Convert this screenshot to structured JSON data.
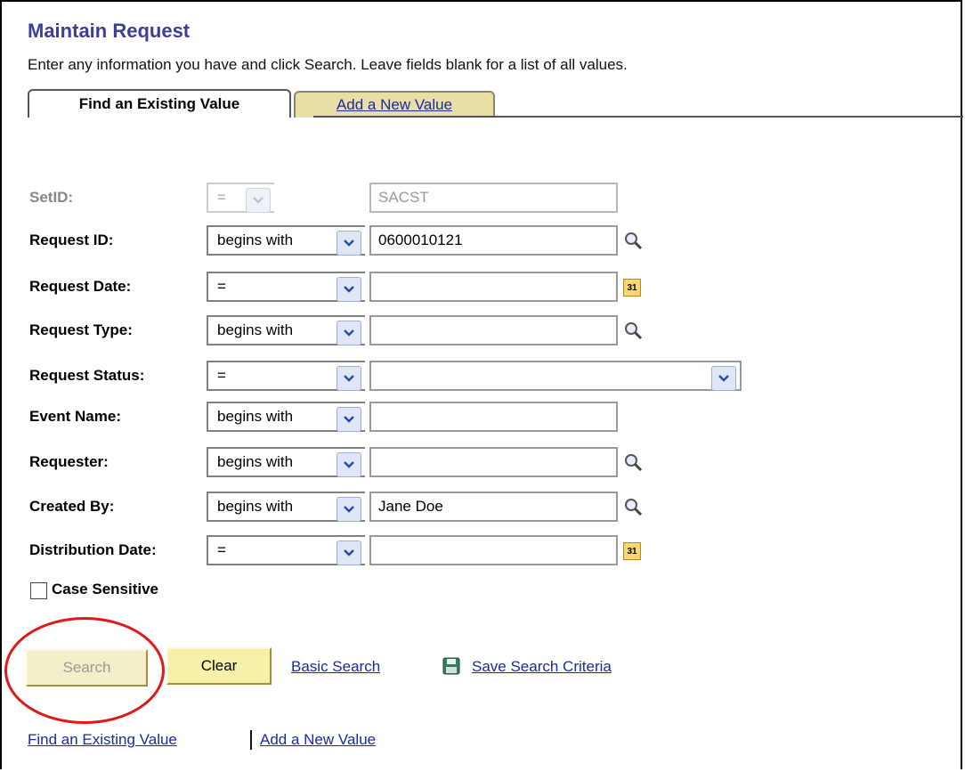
{
  "page": {
    "title": "Maintain Request",
    "instructions": "Enter any information you have and click Search. Leave fields blank for a list of all values."
  },
  "tabs": [
    {
      "label": "Find an Existing Value",
      "active": true
    },
    {
      "label": "Add a New Value",
      "active": false
    }
  ],
  "form": {
    "setid": {
      "label": "SetID:",
      "operator": "=",
      "value": "SACST",
      "disabled": true
    },
    "request_id": {
      "label": "Request ID:",
      "operator": "begins with",
      "value": "0600010121"
    },
    "request_date": {
      "label": "Request Date:",
      "operator": "=",
      "value": ""
    },
    "request_type": {
      "label": "Request Type:",
      "operator": "begins with",
      "value": ""
    },
    "request_status": {
      "label": "Request Status:",
      "operator": "=",
      "value": ""
    },
    "event_name": {
      "label": "Event Name:",
      "operator": "begins with",
      "value": ""
    },
    "requester": {
      "label": "Requester:",
      "operator": "begins with",
      "value": ""
    },
    "created_by": {
      "label": "Created By:",
      "operator": "begins with",
      "value": "Jane Doe"
    },
    "distribution_date": {
      "label": "Distribution Date:",
      "operator": "=",
      "value": ""
    },
    "case_sensitive": {
      "label": "Case Sensitive",
      "checked": false
    }
  },
  "buttons": {
    "search": "Search",
    "clear": "Clear"
  },
  "links": {
    "basic_search": "Basic Search",
    "save_search_criteria": "Save Search Criteria",
    "find_existing": "Find an Existing Value",
    "add_new": "Add a New Value"
  },
  "colors": {
    "title": "#3d3d9a",
    "link": "#1a2aa0",
    "tab_inactive_bg": "#e9dfa4",
    "annotation_circle": "#e01818"
  }
}
